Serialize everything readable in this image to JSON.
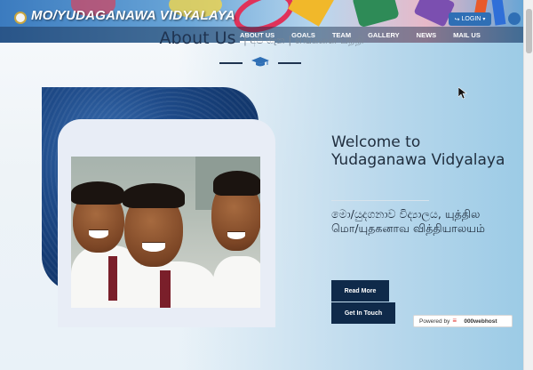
{
  "header": {
    "site_title": "MO/YUDAGANAWA VIDYALAYA",
    "nav": [
      {
        "label": "ABOUT US",
        "active": true
      },
      {
        "label": "GOALS",
        "active": false
      },
      {
        "label": "TEAM",
        "active": false
      },
      {
        "label": "GALLERY",
        "active": false
      },
      {
        "label": "NEWS",
        "active": false
      },
      {
        "label": "MAIL US",
        "active": false
      }
    ],
    "login_label": "LOGIN",
    "login_icon": "sign-in-icon",
    "caret_icon": "caret-down-icon"
  },
  "about": {
    "heading": "About Us",
    "subheading": "| අපි ගැන | எங்களை பற்றி",
    "divider_icon": "graduation-cap-icon"
  },
  "welcome": {
    "title": "Welcome to Yudaganawa Vidyalaya",
    "local_names": "මො/යුදගනාව විද්‍යාලය, யுத்தில மொ/யுதகனாவ வித்தியாலயம்"
  },
  "buttons": {
    "read_more": "Read More",
    "get_in_touch": "Get In Touch"
  },
  "footer": {
    "powered_by": "Powered by",
    "host_name": "000webhost"
  },
  "colors": {
    "nav_accent": "#2f6fb5",
    "dark_button": "#0f2a4a",
    "heading_text": "#1f3350"
  }
}
